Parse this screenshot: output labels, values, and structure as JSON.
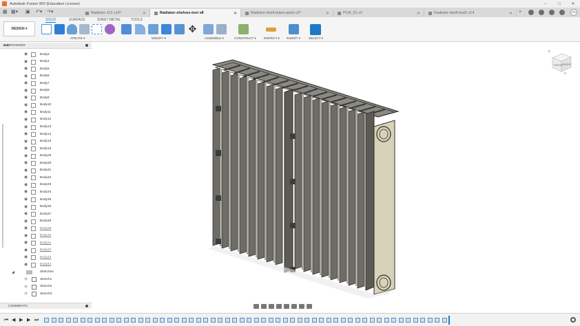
{
  "window": {
    "title": "Autodesk Fusion 360 (Education License)"
  },
  "tabs": [
    {
      "label": "Radiator-112 v10*",
      "active": false
    },
    {
      "label": "Radiator-shelves-test v8",
      "active": true
    },
    {
      "label": "Radiator-shelf-plane-parts v2*",
      "active": false
    },
    {
      "label": "PLW_01 v2",
      "active": false
    },
    {
      "label": "Radiator-shelf-test2 v14",
      "active": false
    }
  ],
  "user": {
    "initials": "PS"
  },
  "ribbon": {
    "workspace": "DESIGN ▾",
    "tabs": [
      "SOLID",
      "SURFACE",
      "SHEET METAL",
      "TOOLS"
    ],
    "groups": [
      "CREATE ▾",
      "MODIFY ▾",
      "ASSEMBLE ▾",
      "CONSTRUCT ▾",
      "INSPECT ▾",
      "INSERT ▾",
      "SELECT ▾"
    ]
  },
  "browser": {
    "title": "BROWSER",
    "bodies": [
      "Body3",
      "Body4",
      "Body5",
      "Body6",
      "Body7",
      "Body8",
      "Body9",
      "Body10",
      "Body11",
      "Body12",
      "Body13",
      "Body14",
      "Body15",
      "Body16",
      "Body29",
      "Body30",
      "Body31",
      "Body32",
      "Body33",
      "Body34",
      "Body35",
      "Body36",
      "Body37",
      "Body38",
      "Body39",
      "Body40",
      "Body41",
      "Body42",
      "Body43",
      "Body44"
    ],
    "folder": "Sketches",
    "sketches": [
      "Sketch1",
      "Sketch2",
      "Sketch3"
    ]
  },
  "comments": {
    "title": "COMMENTS"
  },
  "viewcube": {
    "front": "FRONT",
    "right": "RIGHT",
    "axis_x": "X",
    "axis_z": "Z"
  },
  "colors": {
    "accent": "#1b7ac7",
    "model_dark": "#5b5a55",
    "model_light": "#d8d2b9"
  }
}
